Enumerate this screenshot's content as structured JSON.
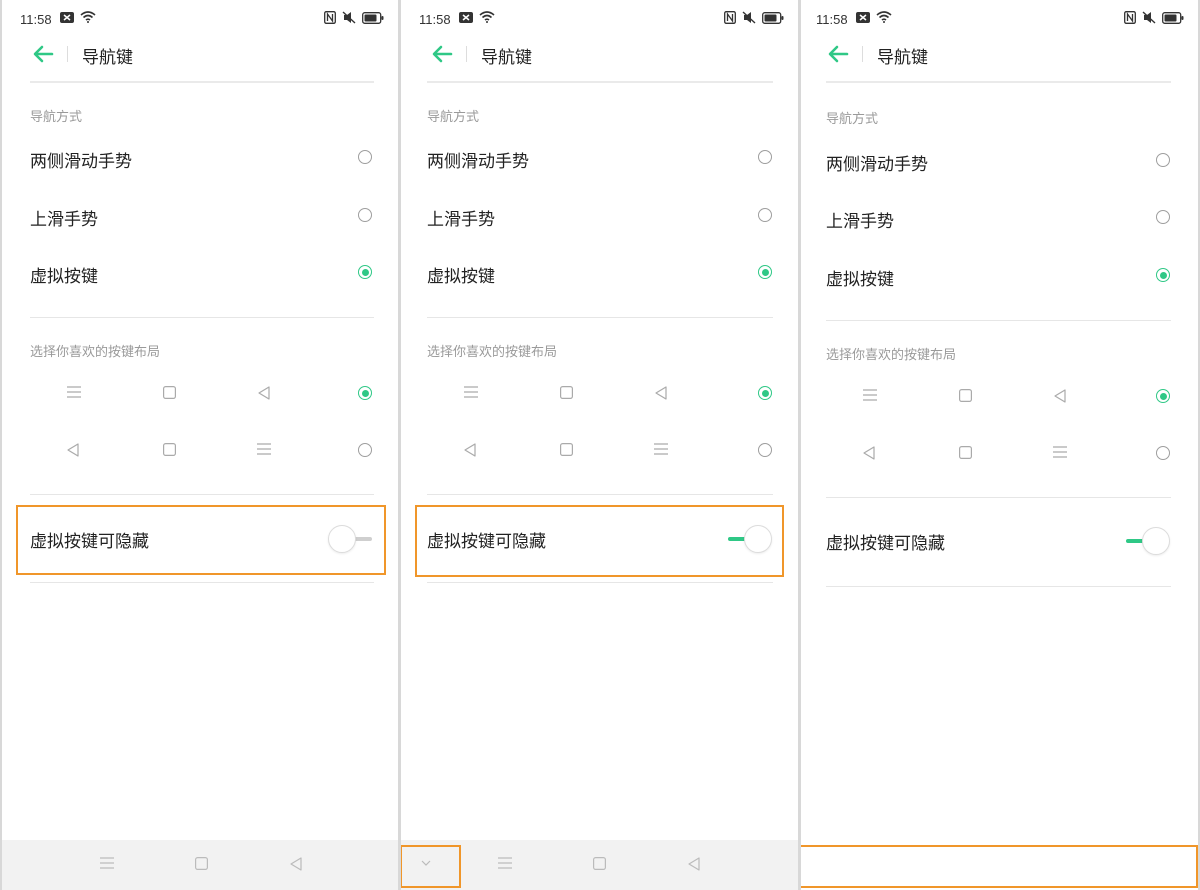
{
  "colors": {
    "accent": "#2fc886",
    "highlight": "#f0962a",
    "text": "#222222",
    "secondary": "#9a9a9a"
  },
  "panels": [
    {
      "status_time": "11:58",
      "title": "导航键",
      "section_nav_mode": "导航方式",
      "nav_options": [
        {
          "label": "两侧滑动手势",
          "selected": false
        },
        {
          "label": "上滑手势",
          "selected": false
        },
        {
          "label": "虚拟按键",
          "selected": true
        }
      ],
      "section_layout": "选择你喜欢的按键布局",
      "layouts": [
        {
          "icons": [
            "menu-icon",
            "home-square-icon",
            "back-triangle-icon"
          ],
          "selected": true
        },
        {
          "icons": [
            "back-triangle-icon",
            "home-square-icon",
            "menu-icon"
          ],
          "selected": false
        }
      ],
      "hideable_label": "虚拟按键可隐藏",
      "hideable_on": false,
      "navbar": [
        "menu-icon",
        "home-square-icon",
        "back-triangle-icon"
      ]
    },
    {
      "status_time": "11:58",
      "title": "导航键",
      "section_nav_mode": "导航方式",
      "nav_options": [
        {
          "label": "两侧滑动手势",
          "selected": false
        },
        {
          "label": "上滑手势",
          "selected": false
        },
        {
          "label": "虚拟按键",
          "selected": true
        }
      ],
      "section_layout": "选择你喜欢的按键布局",
      "layouts": [
        {
          "icons": [
            "menu-icon",
            "home-square-icon",
            "back-triangle-icon"
          ],
          "selected": true
        },
        {
          "icons": [
            "back-triangle-icon",
            "home-square-icon",
            "menu-icon"
          ],
          "selected": false
        }
      ],
      "hideable_label": "虚拟按键可隐藏",
      "hideable_on": true,
      "navbar": [
        "chevron-down-icon",
        "menu-icon",
        "home-square-icon",
        "back-triangle-icon"
      ]
    },
    {
      "status_time": "11:58",
      "title": "导航键",
      "section_nav_mode": "导航方式",
      "nav_options": [
        {
          "label": "两侧滑动手势",
          "selected": false
        },
        {
          "label": "上滑手势",
          "selected": false
        },
        {
          "label": "虚拟按键",
          "selected": true
        }
      ],
      "section_layout": "选择你喜欢的按键布局",
      "layouts": [
        {
          "icons": [
            "menu-icon",
            "home-square-icon",
            "back-triangle-icon"
          ],
          "selected": true
        },
        {
          "icons": [
            "back-triangle-icon",
            "home-square-icon",
            "menu-icon"
          ],
          "selected": false
        }
      ],
      "hideable_label": "虚拟按键可隐藏",
      "hideable_on": true,
      "navbar": []
    }
  ]
}
